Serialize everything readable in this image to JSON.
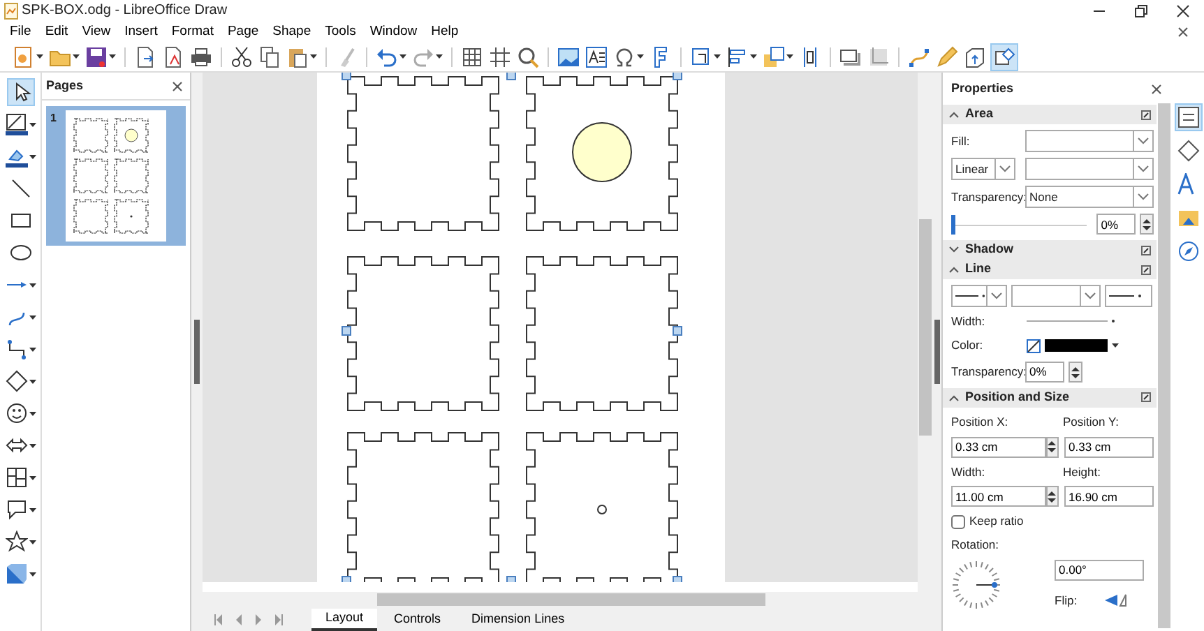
{
  "window": {
    "title": "SPK-BOX.odg - LibreOffice Draw"
  },
  "menu": [
    "File",
    "Edit",
    "View",
    "Insert",
    "Format",
    "Page",
    "Shape",
    "Tools",
    "Window",
    "Help"
  ],
  "pages_panel": {
    "title": "Pages",
    "pages": [
      {
        "number": "1",
        "selected": true
      }
    ]
  },
  "properties": {
    "title": "Properties",
    "area": {
      "title": "Area",
      "expanded": true,
      "fill_label": "Fill:",
      "gradient_type": "Linear",
      "transparency_label": "Transparency:",
      "transparency_value": "None",
      "level": 0,
      "reading": "0%"
    },
    "shadow": {
      "title": "Shadow",
      "expanded": false
    },
    "line": {
      "title": "Line",
      "expanded": true,
      "width_label": "Width:",
      "color_label": "Color:",
      "transparency_label": "Transparency:",
      "transparency_value": "0%"
    },
    "position": {
      "title": "Position and Size",
      "expanded": true,
      "x_label": "Position X:",
      "x_value": "0.33 cm",
      "y_label": "Position Y:",
      "y_value": "0.33 cm",
      "width_label": "Width:",
      "width_value": "11.00 cm",
      "height_label": "Height:",
      "height_value": "16.90 cm",
      "keep_ratio": {
        "label": "Keep ratio",
        "checked": false
      },
      "rotation_label": "Rotation:",
      "rotation_value": "0.00°",
      "flip_label": "Flip:"
    }
  },
  "layer_tabs": [
    {
      "label": "Layout",
      "selected": true
    },
    {
      "label": "Controls",
      "selected": false
    },
    {
      "label": "Dimension Lines",
      "selected": false
    }
  ]
}
